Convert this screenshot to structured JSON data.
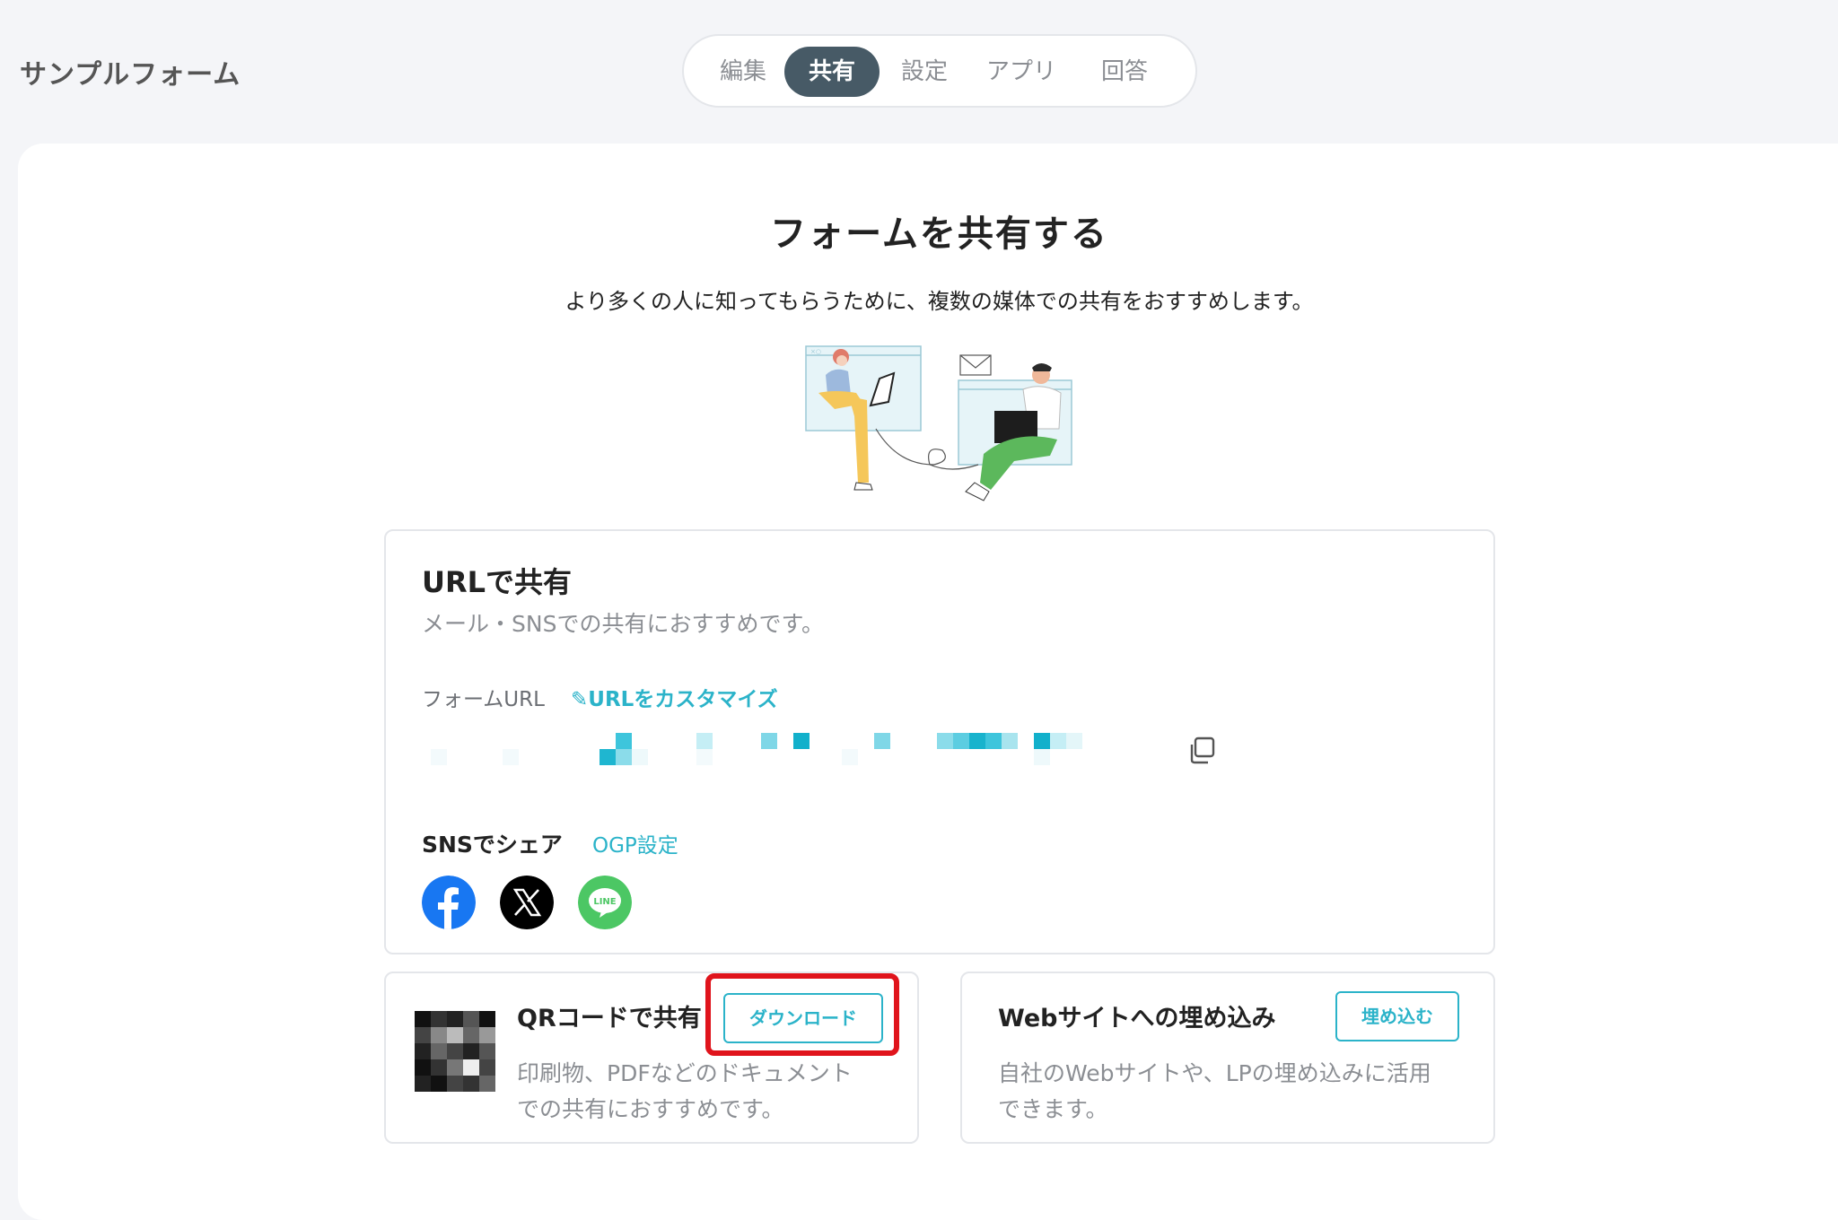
{
  "header": {
    "form_title": "サンプルフォーム",
    "tabs": [
      {
        "label": "編集",
        "active": false
      },
      {
        "label": "共有",
        "active": true
      },
      {
        "label": "設定",
        "active": false
      },
      {
        "label": "アプリ",
        "active": false
      },
      {
        "label": "回答",
        "active": false
      }
    ]
  },
  "main": {
    "heading": "フォームを共有する",
    "subtitle": "より多くの人に知ってもらうために、複数の媒体での共有をおすすめします。"
  },
  "url_share": {
    "title": "URLで共有",
    "description": "メール・SNSでの共有におすすめです。",
    "form_url_label": "フォームURL",
    "customize_link": "URLをカスタマイズ",
    "sns_label": "SNSでシェア",
    "ogp_link": "OGP設定",
    "sns": [
      {
        "name": "Facebook",
        "icon": "facebook-icon",
        "color": "#1877f2"
      },
      {
        "name": "X",
        "icon": "x-icon",
        "color": "#000000"
      },
      {
        "name": "LINE",
        "icon": "line-icon",
        "color": "#4cc764"
      }
    ]
  },
  "qr_share": {
    "title": "QRコードで共有",
    "button": "ダウンロード",
    "description_line1": "印刷物、PDFなどのドキュメント",
    "description_line2": "での共有におすすめです。"
  },
  "embed_share": {
    "title": "Webサイトへの埋め込み",
    "button": "埋め込む",
    "description_line1": "自社のWebサイトや、LPの埋め込みに活用",
    "description_line2": "できます。"
  },
  "colors": {
    "accent": "#2bb3c9",
    "tab_active_bg": "#475a66",
    "highlight": "#e0141c"
  }
}
